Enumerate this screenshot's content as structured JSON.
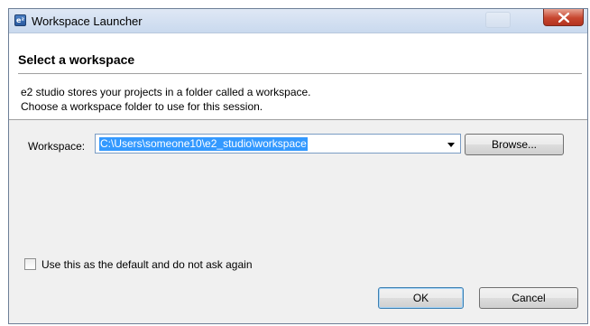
{
  "window": {
    "title": "Workspace Launcher",
    "app_icon_glyph": "e²"
  },
  "header": {
    "title": "Select a workspace",
    "description_line1": "e2 studio stores your projects in a folder called a workspace.",
    "description_line2": "Choose a workspace folder to use for this session."
  },
  "workspace": {
    "label": "Workspace:",
    "value": "C:\\Users\\someone10\\e2_studio\\workspace"
  },
  "buttons": {
    "browse": "Browse...",
    "ok": "OK",
    "cancel": "Cancel"
  },
  "default_checkbox": {
    "label": "Use this as the default and do not ask again",
    "checked": false
  },
  "icons": {
    "app": "eclipse-app-icon",
    "close": "close-icon",
    "dropdown": "chevron-down-icon"
  },
  "colors": {
    "selection_highlight": "#3399ff",
    "close_button": "#c7462f",
    "dialog_background": "#f0f0f0"
  }
}
